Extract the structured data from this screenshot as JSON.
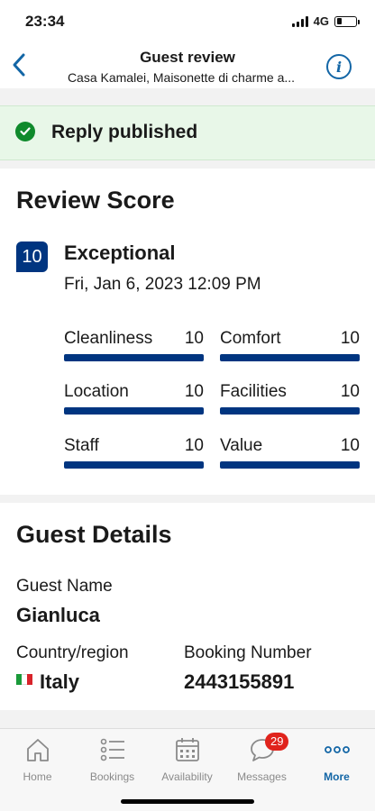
{
  "status_bar": {
    "time": "23:34",
    "network": "4G",
    "battery_level": 0.25
  },
  "nav": {
    "title": "Guest review",
    "subtitle": "Casa Kamalei, Maisonette di charme a..."
  },
  "banner": {
    "text": "Reply published"
  },
  "review_score": {
    "title": "Review Score",
    "score": "10",
    "label": "Exceptional",
    "date": "Fri, Jan 6, 2023 12:09 PM",
    "subscores": [
      {
        "name": "Cleanliness",
        "value": "10",
        "fraction": 1.0
      },
      {
        "name": "Comfort",
        "value": "10",
        "fraction": 1.0
      },
      {
        "name": "Location",
        "value": "10",
        "fraction": 1.0
      },
      {
        "name": "Facilities",
        "value": "10",
        "fraction": 1.0
      },
      {
        "name": "Staff",
        "value": "10",
        "fraction": 1.0
      },
      {
        "name": "Value",
        "value": "10",
        "fraction": 1.0
      }
    ]
  },
  "guest_details": {
    "title": "Guest Details",
    "name_label": "Guest Name",
    "name": "Gianluca",
    "country_label": "Country/region",
    "country": "Italy",
    "booking_label": "Booking Number",
    "booking_number": "2443155891"
  },
  "tabbar": {
    "tabs": [
      {
        "label": "Home",
        "icon": "home-icon"
      },
      {
        "label": "Bookings",
        "icon": "list-icon"
      },
      {
        "label": "Availability",
        "icon": "calendar-icon"
      },
      {
        "label": "Messages",
        "icon": "chat-icon",
        "badge": "29"
      },
      {
        "label": "More",
        "icon": "more-icon",
        "active": true
      }
    ]
  },
  "colors": {
    "accent": "#003580",
    "link": "#1366a6",
    "success": "#0f8a2c",
    "banner_bg": "#e8f7e8",
    "badge": "#e0231c"
  }
}
